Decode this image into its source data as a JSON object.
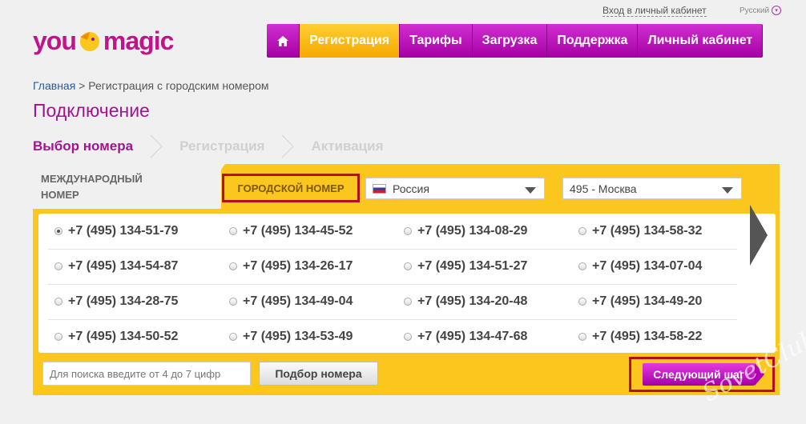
{
  "header": {
    "login_link": "Вход в личный кабинет",
    "language": "Русский",
    "logo_left": "you",
    "logo_right": "magic",
    "nav": [
      {
        "label": "Регистрация",
        "active": true
      },
      {
        "label": "Тарифы"
      },
      {
        "label": "Загрузка"
      },
      {
        "label": "Поддержка"
      },
      {
        "label": "Личный кабинет"
      }
    ]
  },
  "breadcrumb": {
    "home": "Главная",
    "separator": " > ",
    "current": "Регистрация с городским номером"
  },
  "page_title": "Подключение",
  "steps": [
    "Выбор номера",
    "Регистрация",
    "Активация"
  ],
  "tabs": {
    "international": "МЕЖДУНАРОДНЫЙ НОМЕР",
    "city": "ГОРОДСКОЙ НОМЕР"
  },
  "selects": {
    "country": "Россия",
    "area": "495 - Москва"
  },
  "numbers": [
    [
      "+7 (495) 134-51-79",
      "+7 (495) 134-45-52",
      "+7 (495) 134-08-29",
      "+7 (495) 134-58-32"
    ],
    [
      "+7 (495) 134-54-87",
      "+7 (495) 134-26-17",
      "+7 (495) 134-51-27",
      "+7 (495) 134-07-04"
    ],
    [
      "+7 (495) 134-28-75",
      "+7 (495) 134-49-04",
      "+7 (495) 134-20-48",
      "+7 (495) 134-49-20"
    ],
    [
      "+7 (495) 134-50-52",
      "+7 (495) 134-53-49",
      "+7 (495) 134-47-68",
      "+7 (495) 134-58-22"
    ]
  ],
  "selected_number": "+7 (495) 134-51-79",
  "search": {
    "placeholder": "Для поиска введите от 4 до 7 цифр"
  },
  "pick_button": "Подбор номера",
  "next_button": "Следующий шаг",
  "colors": {
    "brand": "#a0158f",
    "accent": "#fbc61d",
    "highlight": "#b40f18"
  },
  "watermark": "SovetClub"
}
